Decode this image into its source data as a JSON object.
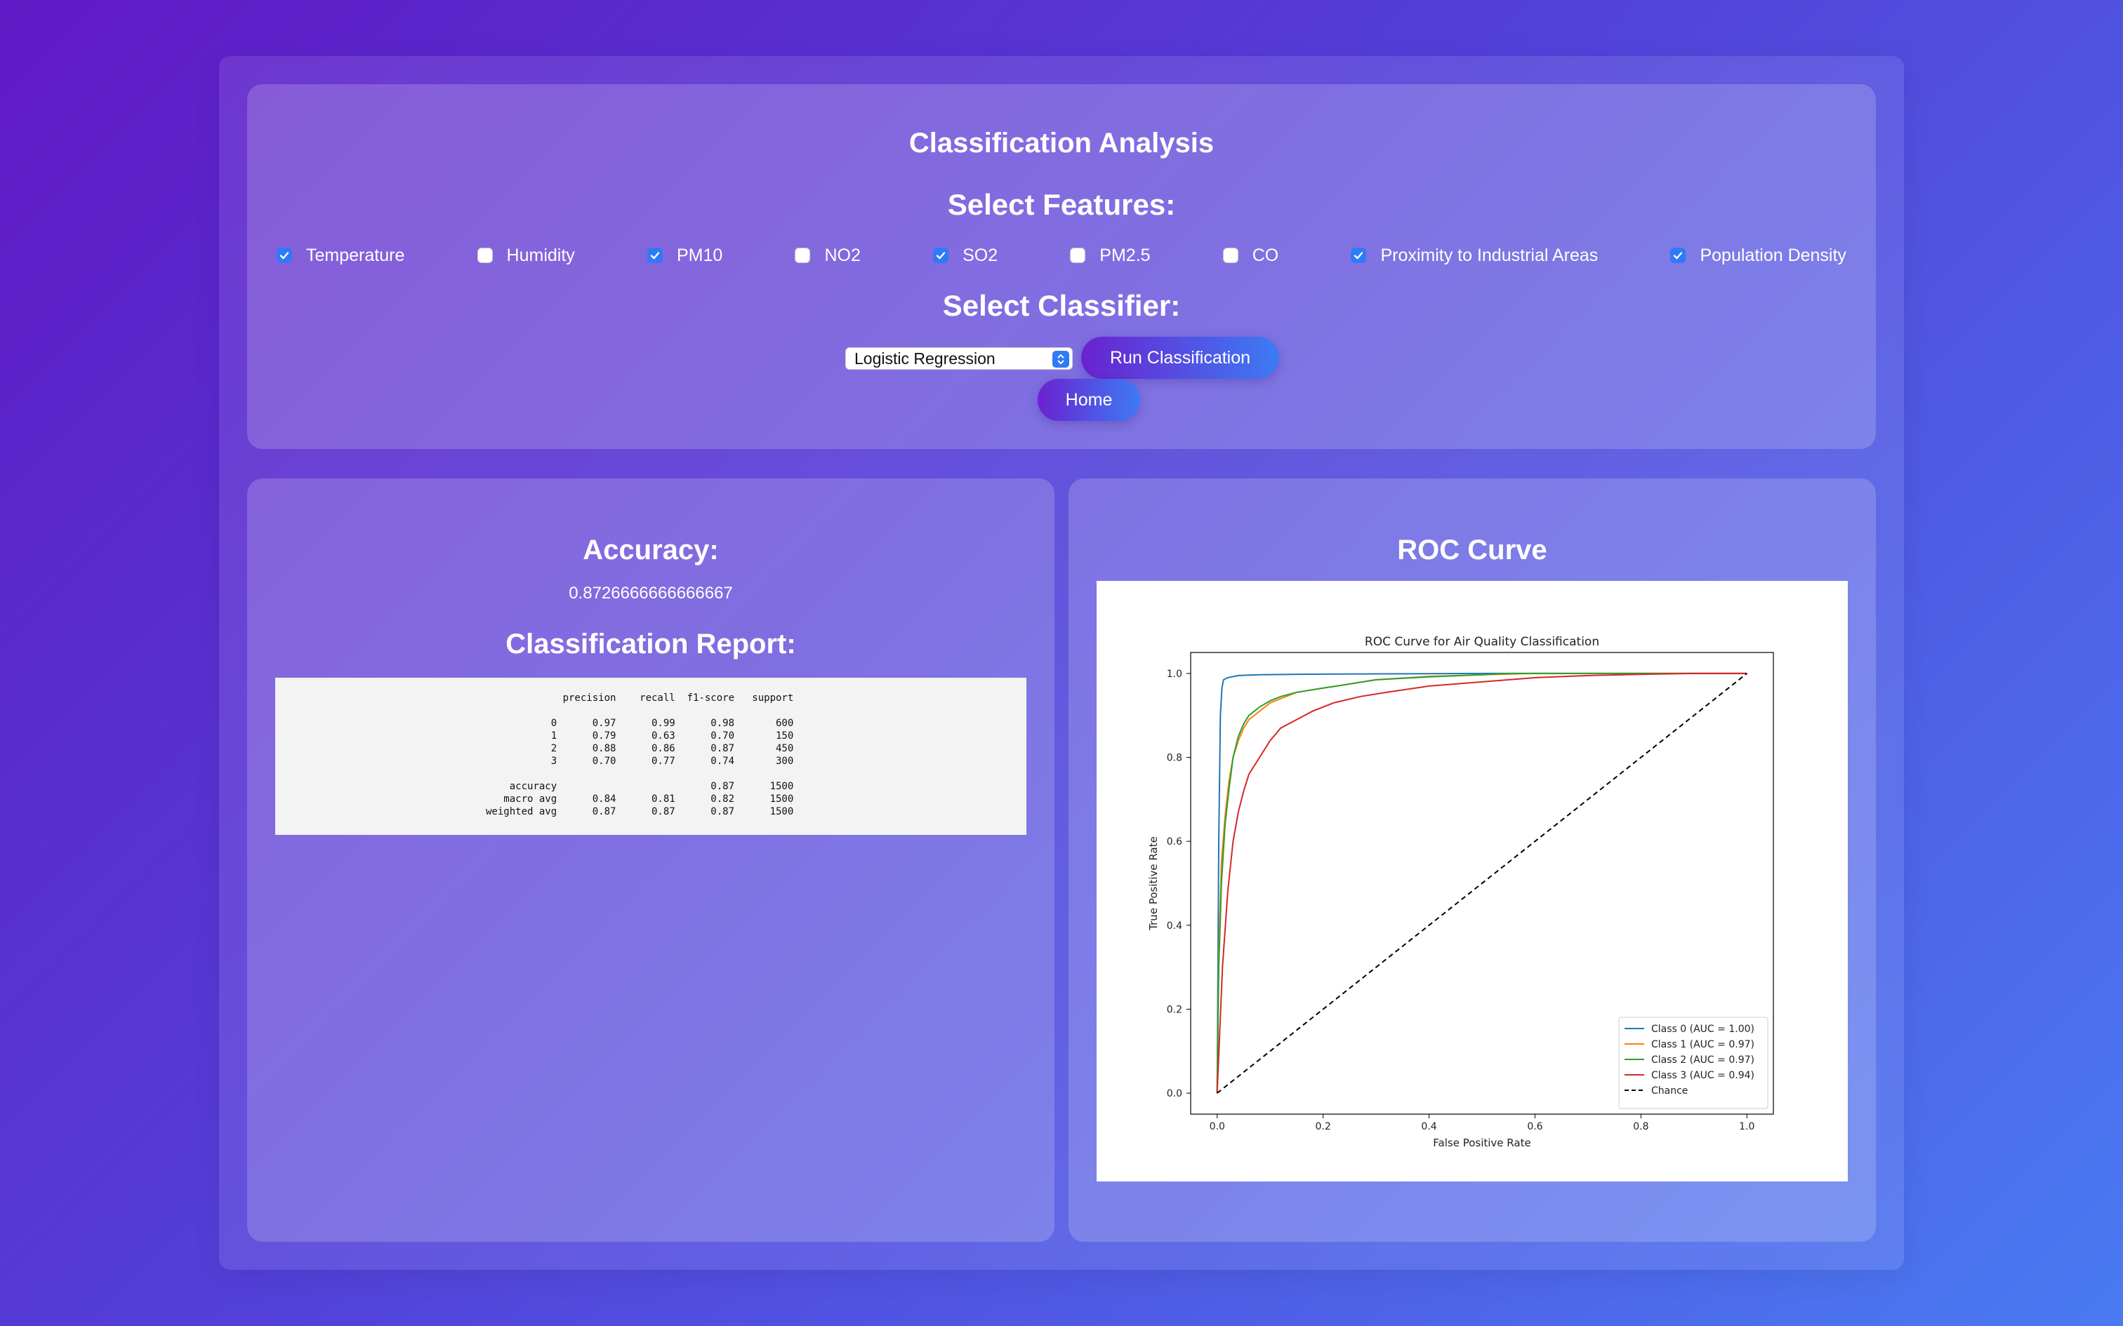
{
  "header": {
    "title": "Classification Analysis",
    "features_title": "Select Features:",
    "classifier_title": "Select Classifier:"
  },
  "features": [
    {
      "label": "Temperature",
      "checked": true
    },
    {
      "label": "Humidity",
      "checked": false
    },
    {
      "label": "PM10",
      "checked": true
    },
    {
      "label": "NO2",
      "checked": false
    },
    {
      "label": "SO2",
      "checked": true
    },
    {
      "label": "PM2.5",
      "checked": false
    },
    {
      "label": "CO",
      "checked": false
    },
    {
      "label": "Proximity to Industrial Areas",
      "checked": true
    },
    {
      "label": "Population Density",
      "checked": true
    }
  ],
  "classifier": {
    "selected": "Logistic Regression",
    "run_label": "Run Classification",
    "home_label": "Home"
  },
  "results": {
    "accuracy_title": "Accuracy:",
    "accuracy_value": "0.8726666666666667",
    "report_title": "Classification Report:",
    "report_header": [
      "",
      "precision",
      "recall",
      "f1-score",
      "support"
    ],
    "report_rows": [
      [
        "0",
        "0.97",
        "0.99",
        "0.98",
        "600"
      ],
      [
        "1",
        "0.79",
        "0.63",
        "0.70",
        "150"
      ],
      [
        "2",
        "0.88",
        "0.86",
        "0.87",
        "450"
      ],
      [
        "3",
        "0.70",
        "0.77",
        "0.74",
        "300"
      ]
    ],
    "report_summary": [
      [
        "accuracy",
        "",
        "",
        "0.87",
        "1500"
      ],
      [
        "macro avg",
        "0.84",
        "0.81",
        "0.82",
        "1500"
      ],
      [
        "weighted avg",
        "0.87",
        "0.87",
        "0.87",
        "1500"
      ]
    ]
  },
  "roc": {
    "panel_title": "ROC Curve"
  },
  "chart_data": {
    "type": "line",
    "title": "ROC Curve for Air Quality Classification",
    "xlabel": "False Positive Rate",
    "ylabel": "True Positive Rate",
    "xlim": [
      -0.05,
      1.05
    ],
    "ylim": [
      -0.05,
      1.05
    ],
    "xticks": [
      "0.0",
      "0.2",
      "0.4",
      "0.6",
      "0.8",
      "1.0"
    ],
    "yticks": [
      "0.0",
      "0.2",
      "0.4",
      "0.6",
      "0.8",
      "1.0"
    ],
    "legend_position": "lower-right",
    "grid": false,
    "series": [
      {
        "name": "Class 0 (AUC = 1.00)",
        "color": "#1f77b4",
        "dash": false,
        "x": [
          0,
          0.003,
          0.006,
          0.009,
          0.012,
          0.02,
          0.04,
          0.08,
          0.15,
          0.3,
          0.5,
          0.7,
          1.0
        ],
        "y": [
          0,
          0.6,
          0.9,
          0.965,
          0.985,
          0.99,
          0.995,
          0.997,
          0.998,
          0.999,
          1.0,
          1.0,
          1.0
        ]
      },
      {
        "name": "Class 1 (AUC = 0.97)",
        "color": "#ff7f0e",
        "dash": false,
        "x": [
          0,
          0.003,
          0.008,
          0.015,
          0.022,
          0.03,
          0.04,
          0.05,
          0.06,
          0.08,
          0.1,
          0.12,
          0.15,
          0.2,
          0.25,
          0.3,
          0.4,
          0.5,
          0.6,
          1.0
        ],
        "y": [
          0,
          0.33,
          0.55,
          0.66,
          0.74,
          0.8,
          0.84,
          0.87,
          0.89,
          0.91,
          0.93,
          0.94,
          0.955,
          0.965,
          0.975,
          0.985,
          0.993,
          0.997,
          1.0,
          1.0
        ]
      },
      {
        "name": "Class 2 (AUC = 0.97)",
        "color": "#2ca02c",
        "dash": false,
        "x": [
          0,
          0.003,
          0.008,
          0.015,
          0.022,
          0.03,
          0.04,
          0.05,
          0.06,
          0.08,
          0.1,
          0.12,
          0.15,
          0.2,
          0.25,
          0.3,
          0.4,
          0.5,
          0.55,
          1.0
        ],
        "y": [
          0,
          0.3,
          0.5,
          0.64,
          0.72,
          0.8,
          0.85,
          0.88,
          0.9,
          0.92,
          0.935,
          0.945,
          0.955,
          0.965,
          0.975,
          0.985,
          0.992,
          0.997,
          1.0,
          1.0
        ]
      },
      {
        "name": "Class 3 (AUC = 0.94)",
        "color": "#d62728",
        "dash": false,
        "x": [
          0,
          0.005,
          0.01,
          0.02,
          0.03,
          0.04,
          0.05,
          0.06,
          0.08,
          0.1,
          0.12,
          0.15,
          0.18,
          0.22,
          0.27,
          0.32,
          0.4,
          0.5,
          0.6,
          0.7,
          0.8,
          0.9,
          1.0
        ],
        "y": [
          0,
          0.15,
          0.3,
          0.48,
          0.6,
          0.67,
          0.72,
          0.76,
          0.8,
          0.84,
          0.87,
          0.89,
          0.91,
          0.93,
          0.945,
          0.955,
          0.97,
          0.98,
          0.99,
          0.995,
          0.998,
          1.0,
          1.0
        ]
      },
      {
        "name": "Chance",
        "color": "#000000",
        "dash": true,
        "x": [
          0,
          1
        ],
        "y": [
          0,
          1
        ]
      }
    ]
  }
}
